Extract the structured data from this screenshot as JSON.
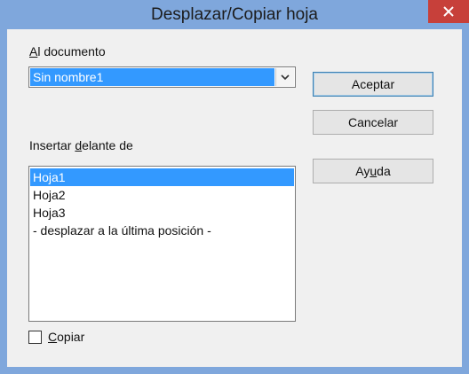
{
  "window": {
    "title": "Desplazar/Copiar hoja"
  },
  "dialog": {
    "document_label_first": "A",
    "document_label_rest": "l documento",
    "document_selected": "Sin nombre1",
    "insert_label_pre": "Insertar ",
    "insert_label_underlined": "d",
    "insert_label_post": "elante de",
    "sheets": [
      "Hoja1",
      "Hoja2",
      "Hoja3",
      "- desplazar a la última posición -"
    ],
    "selected_sheet_index": 0,
    "copy_label_underlined": "C",
    "copy_label_rest": "opiar",
    "copy_checked": false
  },
  "buttons": {
    "ok": "Aceptar",
    "cancel": "Cancelar",
    "help_pre": "Ay",
    "help_underlined": "u",
    "help_post": "da"
  },
  "icons": {
    "close": "close-icon",
    "dropdown": "chevron-down-icon"
  },
  "colors": {
    "selection": "#3399ff",
    "frame": "#7fa7dc",
    "close_button": "#c7403a"
  }
}
